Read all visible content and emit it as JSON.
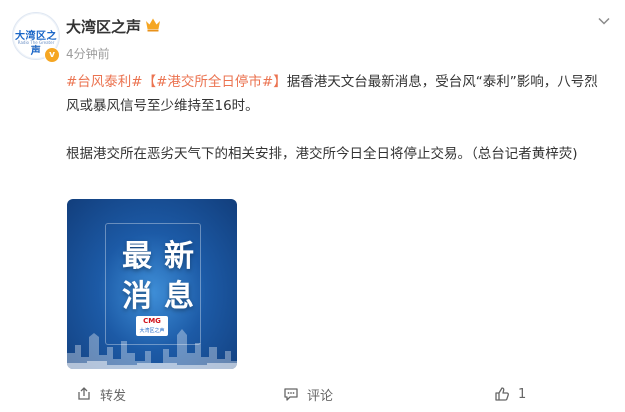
{
  "post": {
    "author": "大湾区之声",
    "time": "4分钟前",
    "avatar_main": "大湾区之声",
    "avatar_sub": "Radio The Greater Bay",
    "tag1": "#台风泰利#",
    "tag2": "【#港交所全日停市#】",
    "para1_rest": "据香港天文台最新消息，受台风“泰利”影响，八号烈风或暴风信号至少维持至16时。",
    "para2": "根据港交所在恶劣天气下的相关安排，港交所今日全日将停止交易。（总台记者黄梓荧)"
  },
  "image": {
    "line1": "最新",
    "line2": "消息",
    "badge_cmg": "CMG",
    "badge_sub": "大湾区之声"
  },
  "footer": {
    "share": "转发",
    "comment": "评论",
    "likes": "1"
  },
  "colors": {
    "tag": "#eb7350",
    "text": "#333333",
    "meta": "#9c9c9c",
    "crown": "#f5a623"
  },
  "icons": [
    "chevron-down-icon",
    "crown-icon",
    "verified-icon",
    "share-icon",
    "comment-icon",
    "like-icon"
  ]
}
